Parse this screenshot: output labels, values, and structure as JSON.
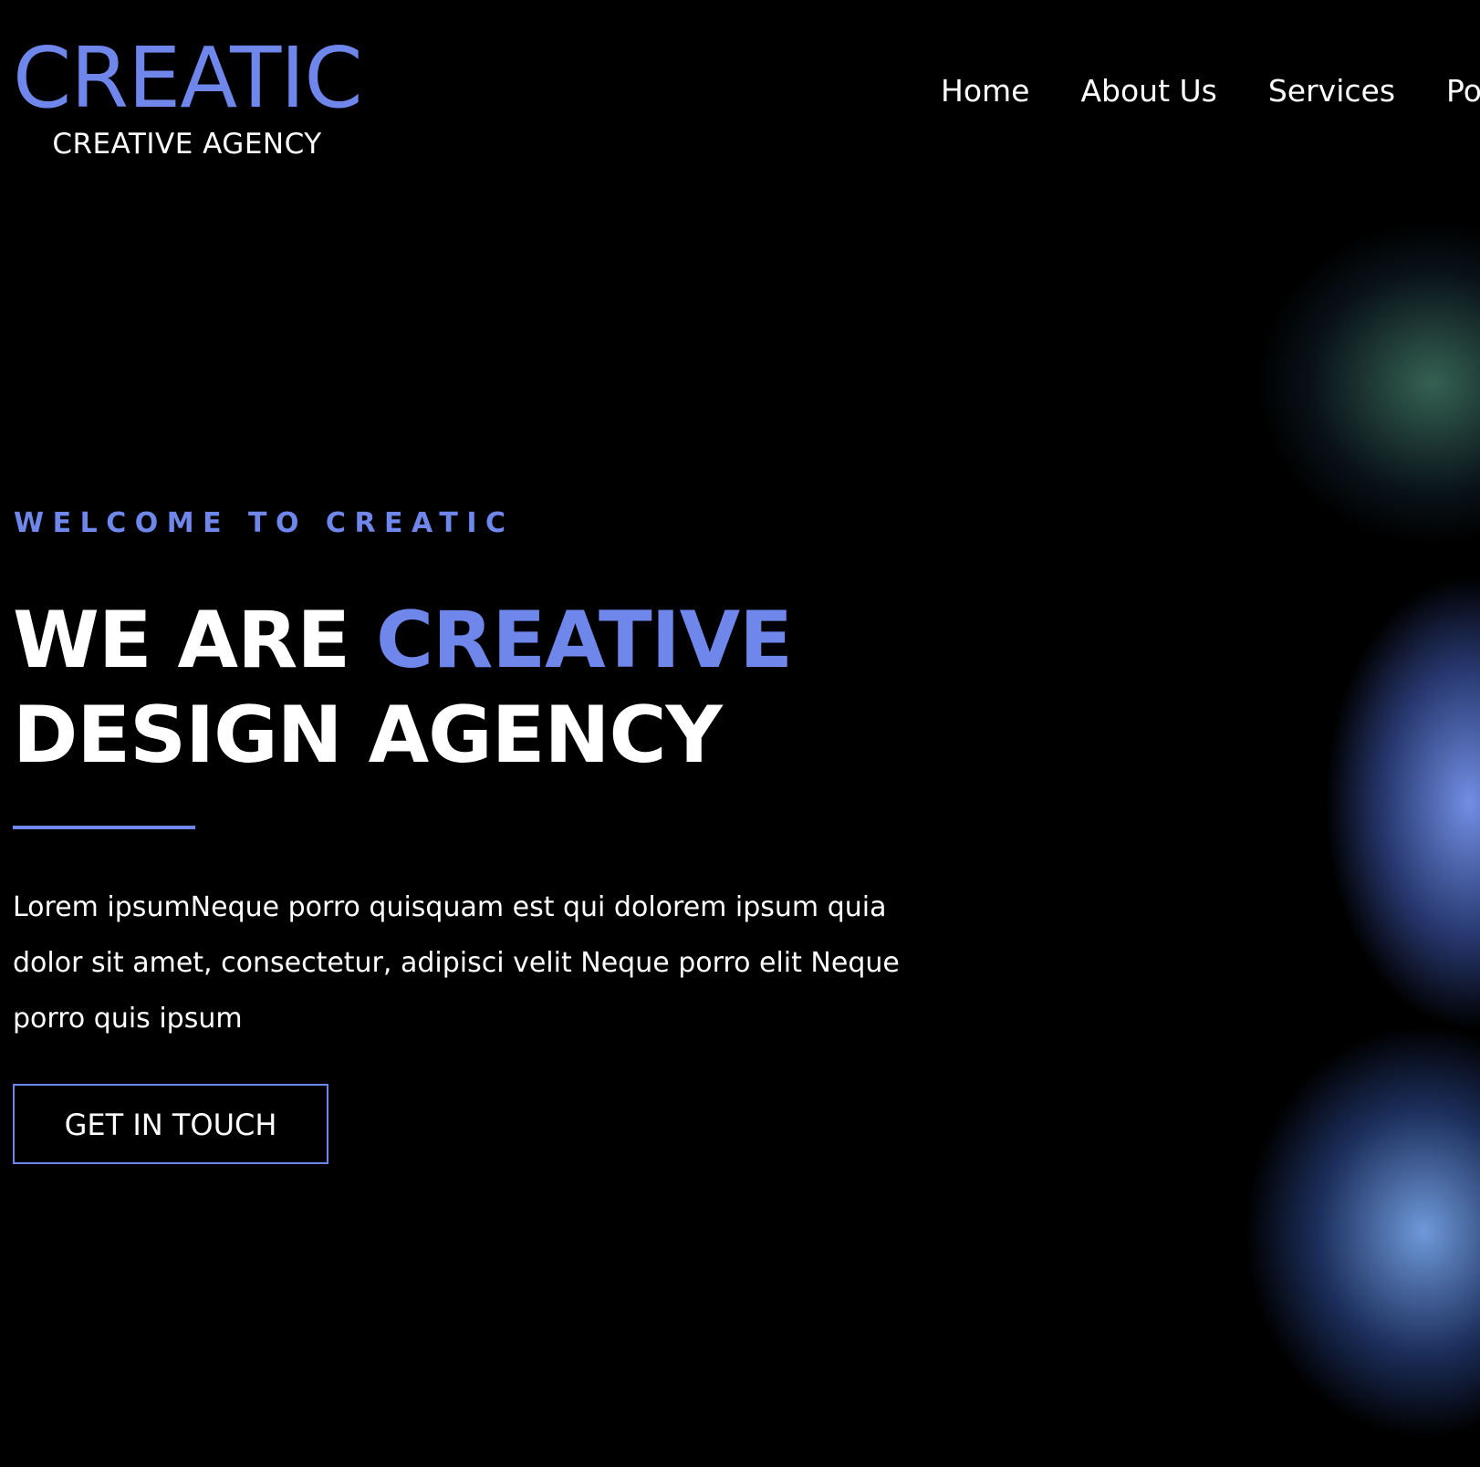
{
  "logo": {
    "title": "CREATIC",
    "subtitle": "CREATIVE AGENCY"
  },
  "nav": {
    "items": [
      "Home",
      "About Us",
      "Services",
      "Port"
    ]
  },
  "hero": {
    "tagline": "WELCOME TO CREATIC",
    "headline_part1": "WE ARE ",
    "headline_accent": "CREATIVE",
    "headline_part2": "DESIGN AGENCY",
    "description": "Lorem ipsumNeque porro quisquam est qui dolorem ipsum quia dolor sit amet, consectetur, adipisci velit Neque porro elit Neque porro quis ipsum",
    "cta_label": "GET IN TOUCH"
  },
  "colors": {
    "accent": "#6f86ea",
    "background": "#000000",
    "text": "#ffffff"
  }
}
